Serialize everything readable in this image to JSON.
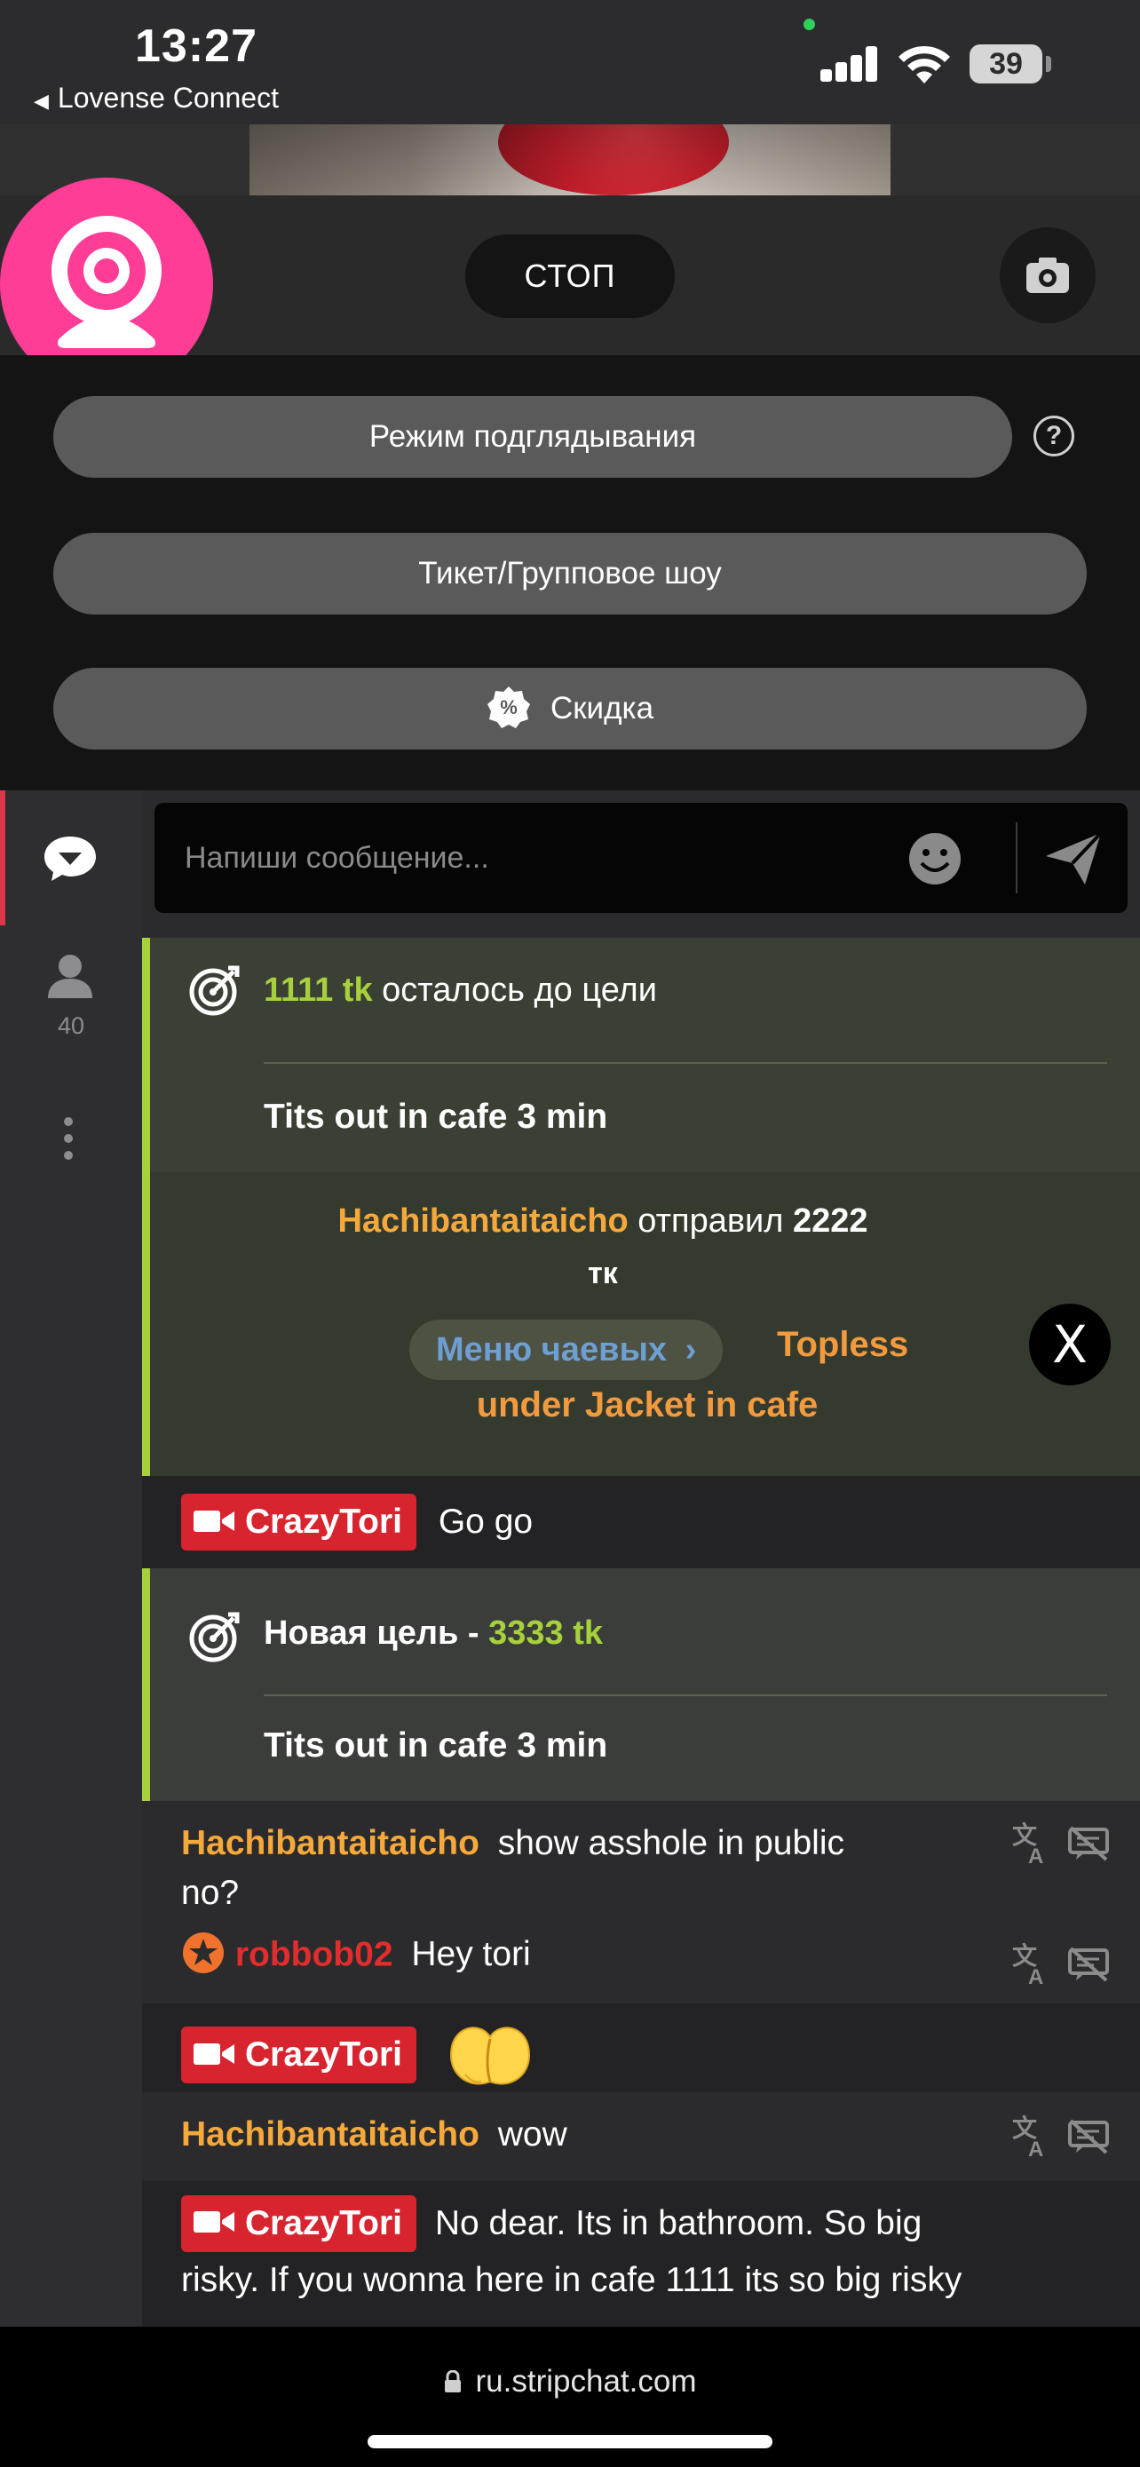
{
  "status_bar": {
    "time": "13:27",
    "back_app": "Lovense Connect",
    "battery": "39"
  },
  "broadcast": {
    "stop_label": "СТОП",
    "camera_switch_icon": "camera-rotate-icon",
    "logo_icon": "webcam-icon"
  },
  "options": {
    "peek_mode": "Режим подглядывания",
    "ticket_show": "Тикет/Групповое шоу",
    "discount": "Скидка",
    "help": "?"
  },
  "sidebar": {
    "chat_icon": "chat-bubble-icon",
    "users_icon": "user-icon",
    "users_count": "40",
    "more_icon": "more-vertical-icon"
  },
  "chat_input": {
    "placeholder": "Напиши сообщение..."
  },
  "goal_1": {
    "amount": "1111 tk",
    "suffix": " осталось до цели",
    "title": "Tits out in cafe 3 min"
  },
  "tip": {
    "user": "Hachibantaitaicho",
    "text": " отправил ",
    "amount": "2222",
    "unit": "тк",
    "menu_label": "Меню чаевых",
    "item_line1": "Topless",
    "item_line2": "under Jacket in cafe",
    "badge": "X"
  },
  "goal_2": {
    "prefix": "Новая цель - ",
    "amount": "3333 tk",
    "title": "Tits out in cafe 3 min"
  },
  "messages": [
    {
      "user": "CrazyTori",
      "text": "Go go"
    },
    {
      "user": "Hachibantaitaicho",
      "text": "show asshole in public",
      "text2": "no?"
    },
    {
      "user": "robbob02",
      "text": "Hey tori"
    },
    {
      "user": "CrazyTori",
      "text": ""
    },
    {
      "user": "Hachibantaitaicho",
      "text": "wow"
    },
    {
      "user": "CrazyTori",
      "text": "No dear. Its in bathroom. So big",
      "text2": "risky. If you wonna here in cafe 1111 its so big risky"
    }
  ],
  "browser": {
    "url": "ru.stripchat.com"
  },
  "colors": {
    "accent_pink": "#ff3d97",
    "goal_lime": "#a6d03c",
    "username_orange": "#f6a93b",
    "model_red": "#d8242f",
    "tip_menu_blue": "#6e9fd3"
  }
}
